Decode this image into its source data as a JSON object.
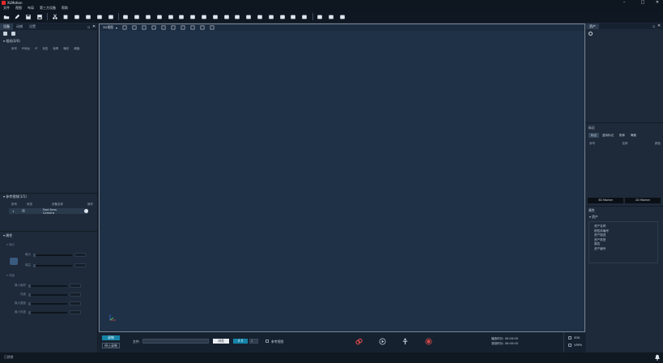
{
  "app": {
    "title": "XLMotion",
    "win_min": "–",
    "win_max": "□",
    "win_close": "✕"
  },
  "menu": [
    "文件",
    "视图",
    "布局",
    "第三方设备",
    "帮助"
  ],
  "toolbar_icons": [
    "folder-icon",
    "pen-icon",
    "save-icon",
    "save-as-icon",
    "cut-icon",
    "device-icon",
    "camera-icon",
    "layout-icon",
    "grid-icon",
    "refresh-icon",
    "cube-icon",
    "sun-icon",
    "monitor-icon",
    "window-icon",
    "split-icon",
    "capture-icon",
    "screen-icon",
    "panel-icon",
    "frame-icon",
    "sync-icon",
    "link-icon",
    "film-icon",
    "record-icon",
    "gear-icon",
    "cloud-icon",
    "share-icon",
    "bar-chart-icon",
    "display-icon",
    "folder-chart-icon",
    "tool-icon"
  ],
  "left": {
    "tabs": [
      "设备",
      "动捕",
      "设置"
    ],
    "section1": {
      "title": "相机(0/0)",
      "columns": [
        "序号",
        "IP地址",
        "IP",
        "状态",
        "帧率",
        "曝光",
        "阈值"
      ]
    },
    "section2": {
      "title": "参考视频(1/1)",
      "columns": [
        "序号",
        "状态",
        "设备名称",
        "操作"
      ],
      "row": {
        "index": "1",
        "state": "启",
        "name": "Fast Sens Camera"
      }
    },
    "section3": {
      "title": "属性",
      "group1": "曝光",
      "g1_items": [
        "曝光",
        "增益"
      ],
      "group2": "阈值",
      "g2_items": [
        "最小面积",
        "亮度",
        "最大圆度",
        "最小亮度"
      ]
    }
  },
  "viewport": {
    "view_select": "3D视图"
  },
  "bottom": {
    "start_btn": "录制",
    "stop_btn": "停止录制",
    "file_label": "文件:",
    "browse_btn": "浏览",
    "speed_value": "4 X",
    "spin_value": "1",
    "ref_video_label": "参考视频",
    "time1_label": "播放时长:",
    "time1_value": "00:00:00",
    "time2_label": "录制时长:",
    "time2_value": "00:00:00",
    "opt1": "SDK",
    "opt2": "VRPN"
  },
  "right": {
    "tab": "资产",
    "section2": "标记",
    "tabs2": [
      "标记",
      "虚拟标记",
      "刚体",
      "骨骼"
    ],
    "columns": [
      "序号",
      "名称",
      "颜色"
    ],
    "marker_btns": [
      "3D Marker",
      "2D Marker"
    ],
    "section3": "属性",
    "prop_group": "资产",
    "prop_items": [
      "资产名称",
      "刚性体编号",
      "资产描述",
      "资产类型",
      "属性",
      "资产编号"
    ]
  },
  "status": {
    "text": "已就绪"
  }
}
